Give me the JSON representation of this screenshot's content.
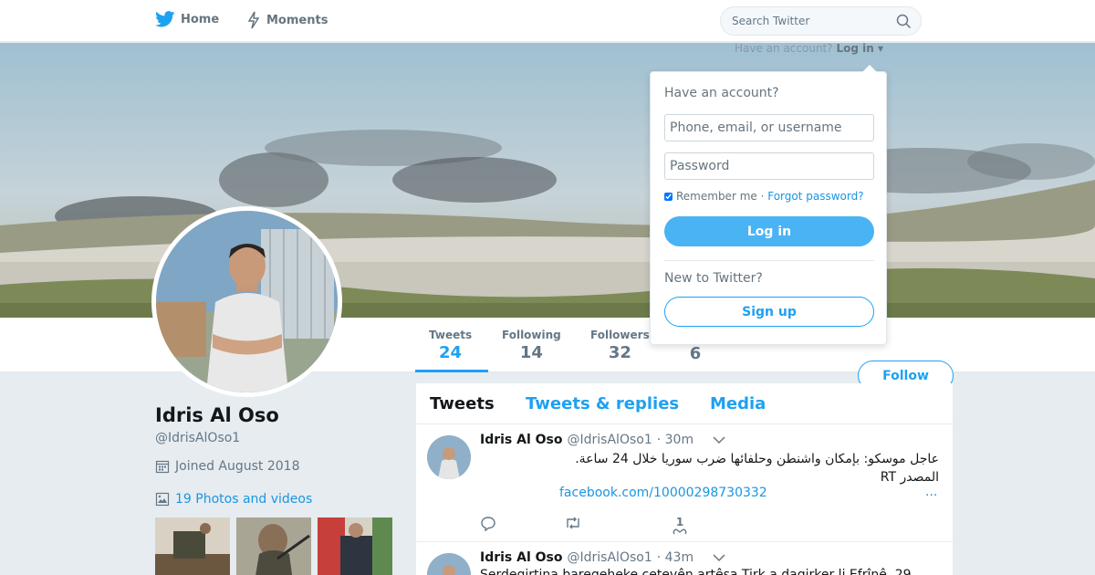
{
  "nav": {
    "home_label": "Home",
    "moments_label": "Moments",
    "search_placeholder": "Search Twitter",
    "home_icon": "twitter-bird-icon",
    "moments_icon": "lightning-icon",
    "search_icon": "magnifier-icon"
  },
  "account_prompt": {
    "text": "Have an account?",
    "login_label": "Log in"
  },
  "login_dropdown": {
    "title": "Have an account?",
    "username_placeholder": "Phone, email, or username",
    "password_placeholder": "Password",
    "remember_label": "Remember me",
    "separator": " · ",
    "forgot_label": "Forgot password?",
    "login_button": "Log in",
    "new_label": "New to Twitter?",
    "signup_button": "Sign up"
  },
  "stats": [
    {
      "label": "Tweets",
      "value": "24"
    },
    {
      "label": "Following",
      "value": "14"
    },
    {
      "label": "Followers",
      "value": "32"
    },
    {
      "label": "",
      "value": "6"
    }
  ],
  "follow_button": "Follow",
  "profile": {
    "name": "Idris Al Oso",
    "handle": "@IdrisAlOso1",
    "joined": "Joined August 2018",
    "photos_link": "19 Photos and videos"
  },
  "timeline": {
    "tabs": [
      "Tweets",
      "Tweets & replies",
      "Media"
    ],
    "tweets": [
      {
        "name": "Idris Al Oso",
        "handle": "@IdrisAlOso1",
        "time": "· 30m",
        "text_line1": "عاجل موسكو: بإمكان واشنطن وحلفائها ضرب سوريا خلال 24 ساعة.",
        "text_line2": "المصدر  RT",
        "link": "facebook.com/10000298730332",
        "more": "...",
        "likes": "1"
      },
      {
        "name": "Idris Al Oso",
        "handle": "@IdrisAlOso1",
        "time": "· 43m",
        "text_line1": "Serdegirtina baregeheke çetevên artêşa Tirk a dagirker li Efrînê. 29"
      }
    ]
  },
  "colors": {
    "accent": "#1da1f2",
    "link": "#1b95e0",
    "muted": "#657786",
    "background": "#e6ecf0"
  }
}
